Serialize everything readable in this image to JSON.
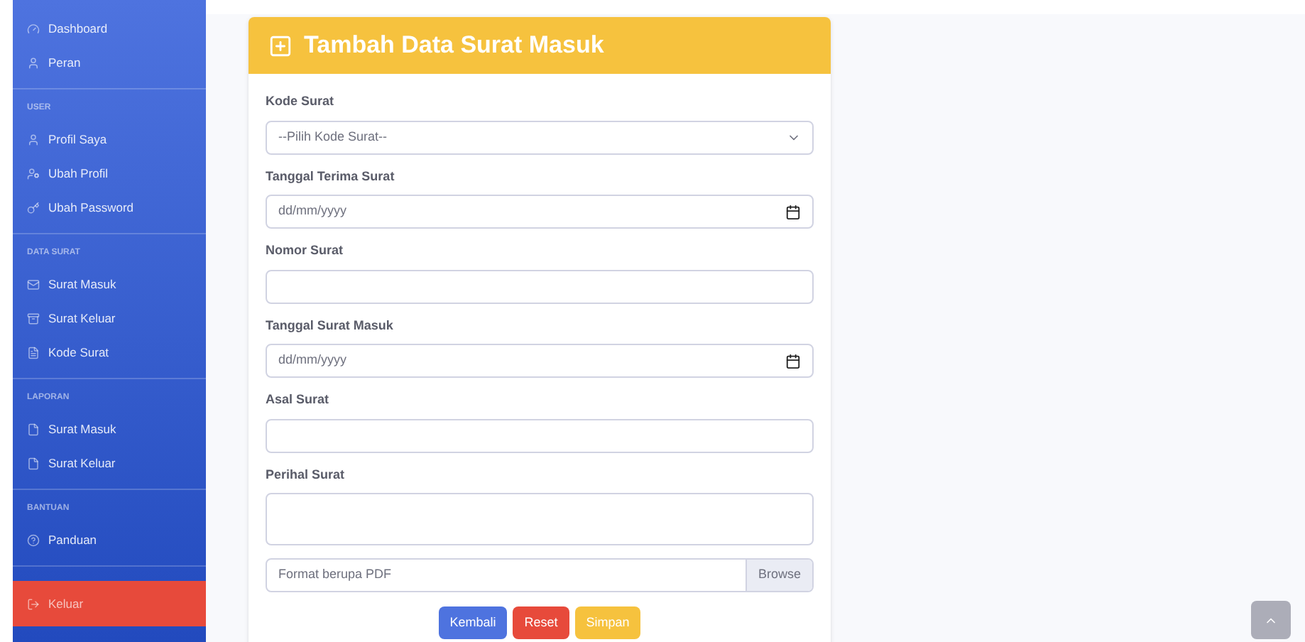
{
  "sidebar": {
    "sections": [
      {
        "items": [
          {
            "label": "Dashboard",
            "selected": false
          },
          {
            "label": "Peran",
            "selected": false
          }
        ]
      },
      {
        "heading": "USER",
        "items": [
          {
            "label": "Profil Saya",
            "selected": false
          },
          {
            "label": "Ubah Profil",
            "selected": false
          },
          {
            "label": "Ubah Password",
            "selected": false
          }
        ]
      },
      {
        "heading": "DATA SURAT",
        "items": [
          {
            "label": "Surat Masuk",
            "selected": false
          },
          {
            "label": "Surat Keluar",
            "selected": false
          },
          {
            "label": "Kode Surat",
            "selected": false
          }
        ]
      },
      {
        "heading": "LAPORAN",
        "items": [
          {
            "label": "Surat Masuk",
            "selected": false
          },
          {
            "label": "Surat Keluar",
            "selected": false
          }
        ]
      },
      {
        "heading": "BANTUAN",
        "items": [
          {
            "label": "Panduan",
            "selected": false
          }
        ]
      },
      {
        "items": [
          {
            "label": "Keluar",
            "selected": true
          }
        ]
      }
    ]
  },
  "form": {
    "title": "Tambah Data Surat Masuk",
    "fields": [
      {
        "kind": "select",
        "label": "Kode Surat",
        "value": "--Pilih Kode Surat--"
      },
      {
        "kind": "date",
        "label": "Tanggal Terima Surat",
        "placeholder": "dd/mm/yyyy"
      },
      {
        "kind": "text",
        "label": "Nomor Surat"
      },
      {
        "kind": "date",
        "label": "Tanggal Surat Masuk",
        "placeholder": "dd/mm/yyyy"
      },
      {
        "kind": "text",
        "label": "Asal Surat"
      },
      {
        "kind": "textarea",
        "label": "Perihal Surat"
      },
      {
        "kind": "file",
        "placeholder": "Format berupa PDF",
        "button": "Browse"
      }
    ],
    "buttons": [
      {
        "label": "Kembali",
        "kind": "primary"
      },
      {
        "label": "Reset",
        "kind": "danger"
      },
      {
        "label": "Simpan",
        "kind": "warning"
      }
    ]
  }
}
